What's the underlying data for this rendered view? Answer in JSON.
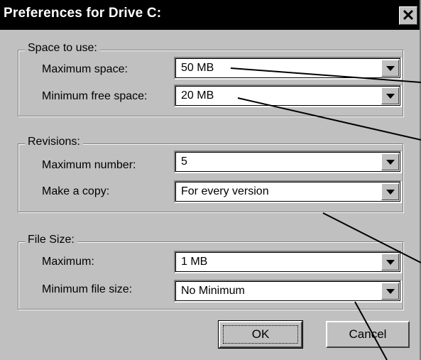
{
  "window": {
    "title": "Preferences for Drive C:",
    "close_glyph": "✕"
  },
  "groups": {
    "space": {
      "legend": "Space to use:",
      "max_label": "Maximum space:",
      "max_value": "50 MB",
      "min_label": "Minimum free space:",
      "min_value": "20 MB"
    },
    "revisions": {
      "legend": "Revisions:",
      "max_label": "Maximum number:",
      "max_value": "5",
      "copy_label": "Make a copy:",
      "copy_value": "For every version"
    },
    "filesize": {
      "legend": "File Size:",
      "max_label": "Maximum:",
      "max_value": "1 MB",
      "min_label": "Minimum file size:",
      "min_value": "No Minimum"
    }
  },
  "buttons": {
    "ok": "OK",
    "cancel": "Cancel"
  },
  "icons": [
    "close-icon",
    "dropdown-arrow-icon"
  ],
  "colors": {
    "titlebar": "#000000",
    "face": "#c0c0c0",
    "field": "#ffffff"
  }
}
